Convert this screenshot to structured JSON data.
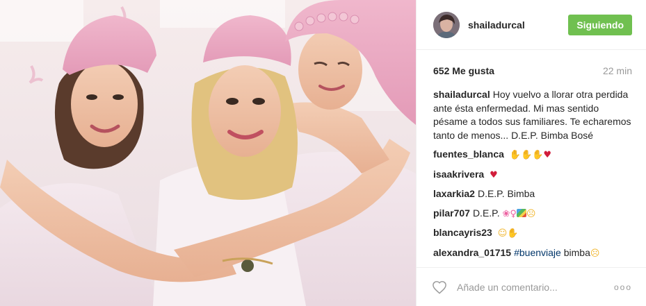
{
  "post": {
    "author": "shailadurcal",
    "follow_label": "Siguiendo",
    "likes": "652 Me gusta",
    "time": "22 min",
    "caption_user": "shailadurcal",
    "caption_text": "Hoy vuelvo a llorar otra perdida ante ésta enfermedad. Mi mas sentido pésame a todos sus familiares. Te echaremos tanto de menos... D.E.P. Bimba Bosé"
  },
  "comments": [
    {
      "user": "fuentes_blanca",
      "text": ""
    },
    {
      "user": "isaakrivera",
      "text": ""
    },
    {
      "user": "laxarkia2",
      "text": "D.E.P. Bimba"
    },
    {
      "user": "pilar707",
      "text": "D.E.P."
    },
    {
      "user": "blancayris23",
      "text": ""
    },
    {
      "user": "alexandra_01715",
      "hashtag": "#buenviaje",
      "text": "bimba"
    }
  ],
  "add_comment": {
    "placeholder": "Añade un comentario..."
  },
  "icons": {
    "like": "heart-outline-icon",
    "options": "more-options-icon"
  },
  "colors": {
    "follow_button": "#70c050",
    "hashtag": "#003569",
    "muted": "#999999"
  }
}
